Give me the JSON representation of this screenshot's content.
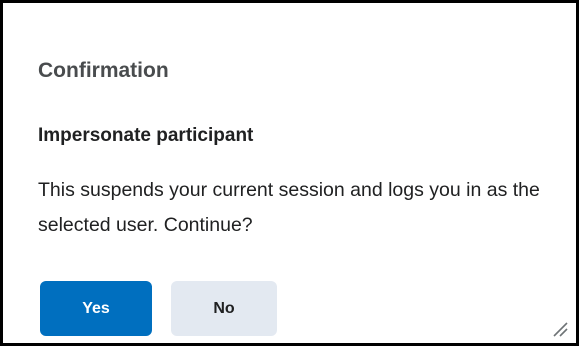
{
  "dialog": {
    "title": "Confirmation",
    "heading": "Impersonate participant",
    "message": "This suspends your current session and logs you in as the selected user. Continue?",
    "buttons": {
      "yes_label": "Yes",
      "no_label": "No"
    },
    "colors": {
      "primary_button": "#006fbf",
      "secondary_button": "#e3e9f1",
      "title_text": "#494c4e",
      "body_text": "#202122"
    },
    "icons": {
      "resize_handle": "resize-handle-icon"
    }
  }
}
